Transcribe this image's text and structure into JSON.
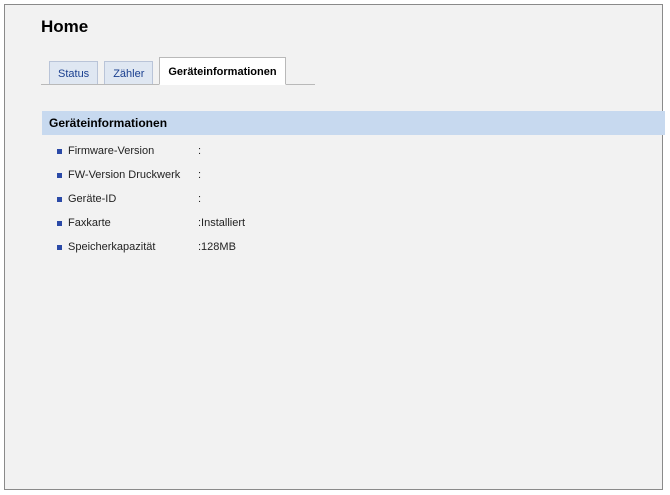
{
  "page": {
    "title": "Home"
  },
  "tabs": [
    {
      "label": "Status",
      "active": false
    },
    {
      "label": "Zähler",
      "active": false
    },
    {
      "label": "Geräteinformationen",
      "active": true
    }
  ],
  "section": {
    "title": "Geräteinformationen",
    "rows": [
      {
        "label": "Firmware-Version",
        "value": ":"
      },
      {
        "label": "FW-Version Druckwerk",
        "value": ":"
      },
      {
        "label": "Geräte-ID",
        "value": ":"
      },
      {
        "label": "Faxkarte",
        "value": ":Installiert"
      },
      {
        "label": "Speicherkapazität",
        "value": ":128MB"
      }
    ]
  },
  "colors": {
    "section_header_bg": "#c7d9ef",
    "bullet": "#2b4aa7",
    "tab_link": "#1a3f8f",
    "panel_bg": "#f2f2f2"
  },
  "icons": {
    "row_bullet": "square-bullet-icon"
  }
}
